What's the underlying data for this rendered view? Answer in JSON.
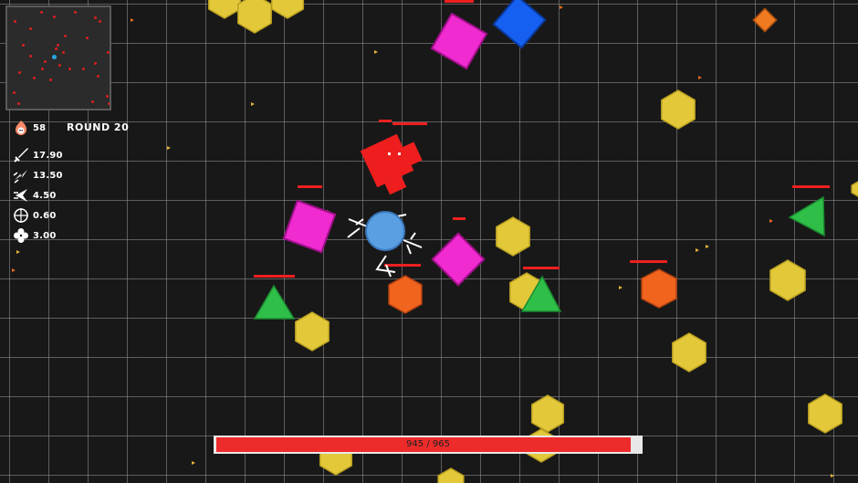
{
  "hud": {
    "kills": "58",
    "round": "ROUND 20",
    "stats": [
      {
        "icon": "sword-icon",
        "value": "17.90"
      },
      {
        "icon": "lightning-icon",
        "value": "13.50"
      },
      {
        "icon": "speed-arrow-icon",
        "value": "4.50"
      },
      {
        "icon": "crosshair-icon",
        "value": "0.60"
      },
      {
        "icon": "clover-icon",
        "value": "3.00"
      }
    ],
    "kills_icon": "flame-skull-icon"
  },
  "health": {
    "current": 945,
    "max": 965,
    "label": "945 / 965"
  },
  "colors": {
    "background": "#181818",
    "grid": "#969696",
    "player": "#5b9fe3",
    "hexagon": "#e3c93a",
    "square_magenta": "#f02bd0",
    "square_blue": "#1560f0",
    "triangle": "#2fbf48",
    "pentagon_orange": "#f0641e",
    "boss_red": "#ee1e1e",
    "health_bar": "#ee2b2b"
  }
}
